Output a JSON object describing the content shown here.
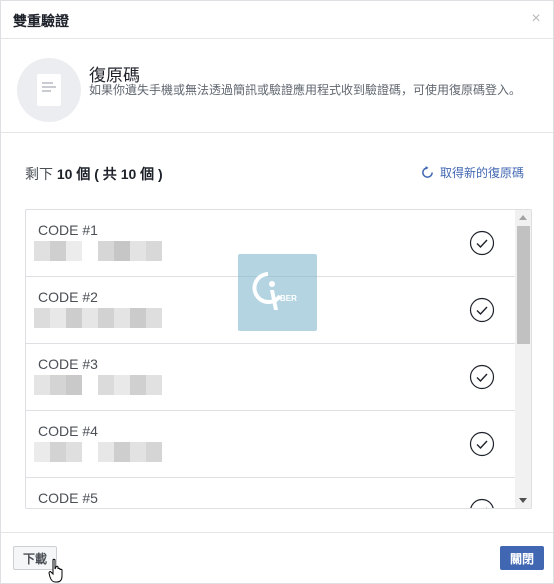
{
  "dialog": {
    "title": "雙重驗證",
    "close_glyph": "×"
  },
  "intro": {
    "title": "復原碼",
    "description": "如果你遺失手機或無法透過簡訊或驗證應用程式收到驗證碼，可使用復原碼登入。"
  },
  "status": {
    "prefix": "剩下",
    "remaining": "10",
    "unit": "個",
    "total_text": "( 共",
    "total": "10",
    "total_suffix": "個 )",
    "refresh_label": "取得新的復原碼"
  },
  "codes": [
    {
      "label": "CODE #1",
      "value_hidden": true,
      "used": false
    },
    {
      "label": "CODE #2",
      "value_hidden": true,
      "used": false
    },
    {
      "label": "CODE #3",
      "value_hidden": true,
      "used": false
    },
    {
      "label": "CODE #4",
      "value_hidden": true,
      "used": false
    },
    {
      "label": "CODE #5",
      "value_hidden": true,
      "used": false
    }
  ],
  "watermark": {
    "text": "BER"
  },
  "footer": {
    "download_label": "下載",
    "close_label": "關閉"
  },
  "colors": {
    "accent": "#4267b2",
    "border": "#dddfe2",
    "icon_bg": "#ebedf0",
    "watermark": "#82b8cf"
  },
  "icons": {
    "close": "close-icon",
    "document": "document-icon",
    "refresh": "refresh-icon",
    "check": "check-circle-icon",
    "cursor": "hand-pointer-icon"
  }
}
